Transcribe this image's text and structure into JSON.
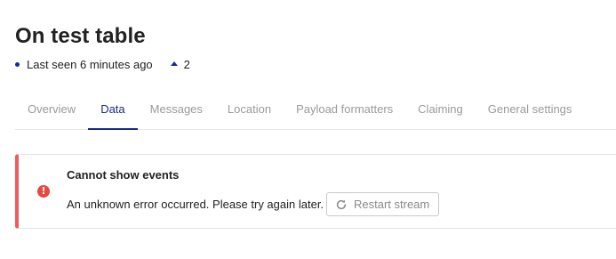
{
  "device": {
    "title": "On test table",
    "last_seen": "Last seen 6 minutes ago",
    "uplink_count": "2"
  },
  "tabs": [
    {
      "label": "Overview",
      "active": false
    },
    {
      "label": "Data",
      "active": true
    },
    {
      "label": "Messages",
      "active": false
    },
    {
      "label": "Location",
      "active": false
    },
    {
      "label": "Payload formatters",
      "active": false
    },
    {
      "label": "Claiming",
      "active": false
    },
    {
      "label": "General settings",
      "active": false
    }
  ],
  "error": {
    "title": "Cannot show events",
    "message": "An unknown error occurred. Please try again later.",
    "button_label": "Restart stream",
    "icon": "error-icon",
    "accent_color": "#f05a5a"
  },
  "colors": {
    "brand": "#1a2a8a",
    "error": "#e8483d"
  }
}
